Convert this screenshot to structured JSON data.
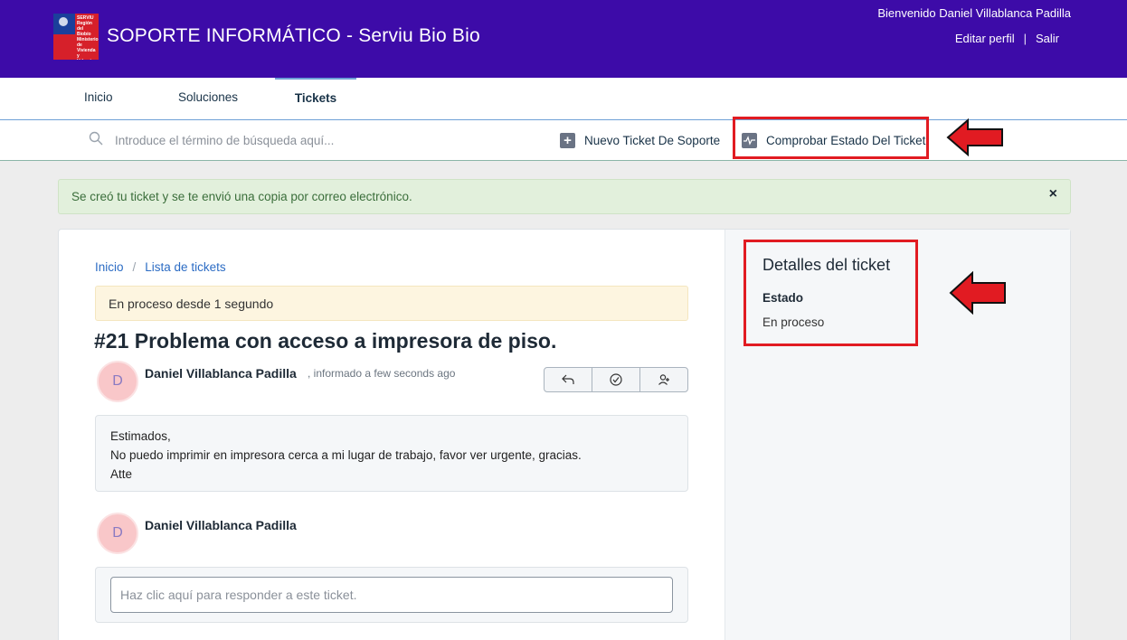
{
  "header": {
    "logo_text": "SERVIU Región del Biobío Ministerio de Vivienda y Urbanismo",
    "title": "SOPORTE INFORMÁTICO - Serviu Bio Bio",
    "welcome": "Bienvenido Daniel Villablanca Padilla",
    "edit_profile": "Editar perfil",
    "separator": "|",
    "logout": "Salir"
  },
  "nav": {
    "tabs": [
      {
        "label": "Inicio",
        "active": false
      },
      {
        "label": "Soluciones",
        "active": false
      },
      {
        "label": "Tickets",
        "active": true
      }
    ]
  },
  "search": {
    "placeholder": "Introduce el término de búsqueda aquí..."
  },
  "actions": {
    "new_ticket": "Nuevo Ticket De Soporte",
    "check_status": "Comprobar Estado Del Ticket"
  },
  "alert": {
    "message": "Se creó tu ticket y se te envió una copia por correo electrónico.",
    "close": "×"
  },
  "breadcrumb": {
    "home": "Inicio",
    "separator": "/",
    "list": "Lista de tickets"
  },
  "ticket": {
    "status_banner": "En proceso desde 1 segundo",
    "title": "#21 Problema con acceso a impresora de piso.",
    "author": "Daniel Villablanca Padilla",
    "author_initial": "D",
    "reported_suffix": ", informado a few seconds ago",
    "message_lines": [
      "Estimados,",
      "No puedo imprimir en impresora cerca a mi lugar de trabajo, favor ver urgente, gracias.",
      "Atte"
    ]
  },
  "reply": {
    "author": "Daniel Villablanca Padilla",
    "author_initial": "D",
    "placeholder": "Haz clic aquí para responder a este ticket."
  },
  "details": {
    "title": "Detalles del ticket",
    "status_label": "Estado",
    "status_value": "En proceso"
  },
  "colors": {
    "header_bg": "#3d0ba8",
    "highlight_red": "#e11b22",
    "link_blue": "#2c6cc4",
    "alert_green_bg": "#e2f0dc"
  }
}
